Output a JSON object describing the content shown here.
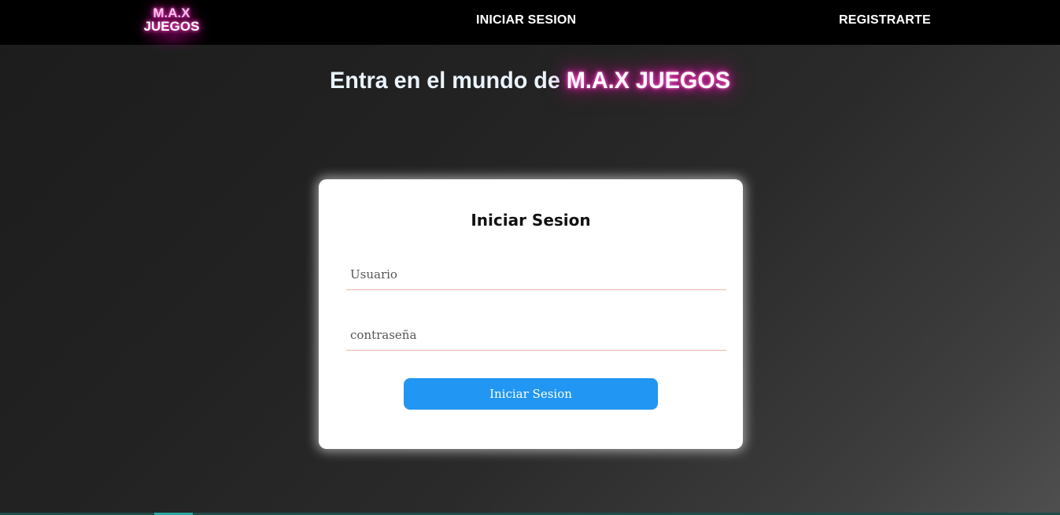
{
  "header": {
    "logo_line1": "M.A.X",
    "logo_line2": "JUEGOS",
    "nav": {
      "login": "INICIAR SESION",
      "register": "REGISTRARTE"
    }
  },
  "hero": {
    "prefix": "Entra en el mundo de ",
    "brand": "M.A.X JUEGOS"
  },
  "login_form": {
    "title": "Iniciar Sesion",
    "username_placeholder": "Usuario",
    "username_value": "",
    "password_placeholder": "contraseña",
    "password_value": "",
    "submit_label": "Iniciar Sesion"
  },
  "colors": {
    "header_background": "#000000",
    "neon_accent": "#ff2fb8",
    "button_background": "#2196f3",
    "field_underline": "#f0b3aa",
    "card_background": "#ffffff"
  }
}
